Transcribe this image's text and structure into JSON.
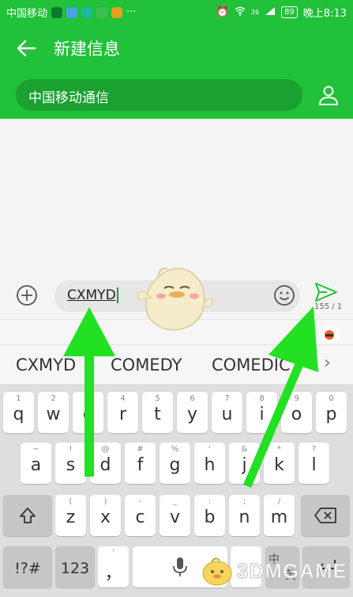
{
  "status_bar": {
    "carrier": "中国移动",
    "signal": "26",
    "battery": "89",
    "time": "晚上8:13"
  },
  "header": {
    "title": "新建信息",
    "recipient": "中国移动通信"
  },
  "compose": {
    "message": "CXMYD",
    "counter": "155 / 1"
  },
  "suggestions": [
    "CXMYD",
    "COMEDY",
    "COMEDIC"
  ],
  "keyboard": {
    "row1": [
      {
        "sup": "1",
        "key": "q"
      },
      {
        "sup": "2",
        "key": "w"
      },
      {
        "sup": "3",
        "key": "e"
      },
      {
        "sup": "4",
        "key": "r"
      },
      {
        "sup": "5",
        "key": "t"
      },
      {
        "sup": "6",
        "key": "y"
      },
      {
        "sup": "7",
        "key": "u"
      },
      {
        "sup": "8",
        "key": "i"
      },
      {
        "sup": "9",
        "key": "o"
      },
      {
        "sup": "0",
        "key": "p"
      }
    ],
    "row2": [
      {
        "sup": "~",
        "key": "a"
      },
      {
        "sup": "!",
        "key": "s"
      },
      {
        "sup": "@",
        "key": "d"
      },
      {
        "sup": "#",
        "key": "f"
      },
      {
        "sup": "%",
        "key": "g"
      },
      {
        "sup": "'",
        "key": "h"
      },
      {
        "sup": "&",
        "key": "j"
      },
      {
        "sup": "*",
        "key": "k"
      },
      {
        "sup": "?",
        "key": "l"
      }
    ],
    "row3": [
      {
        "sup": "(",
        "key": "z"
      },
      {
        "sup": ")",
        "key": "x"
      },
      {
        "sup": "-",
        "key": "c"
      },
      {
        "sup": "_",
        "key": "v"
      },
      {
        "sup": ":",
        "key": "b"
      },
      {
        "sup": ";",
        "key": "n"
      },
      {
        "sup": "/",
        "key": "m"
      }
    ],
    "symbols": "!?#",
    "numbers": "123",
    "comma_top": "’",
    "comma": "，",
    "lang_left": "中",
    "lang_right": "英"
  },
  "watermark": "3DMGAME",
  "colors": {
    "accent": "#21c13a",
    "arrow": "#22e022"
  }
}
